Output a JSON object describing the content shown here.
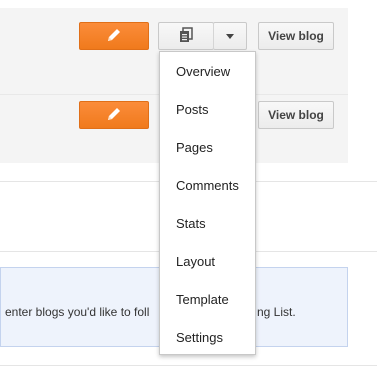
{
  "blog_rows": [
    {
      "view_blog_label": "View blog"
    },
    {
      "view_blog_label": "View blog"
    }
  ],
  "notice": {
    "text_left": "enter blogs you'd like to foll",
    "text_right": "ng List."
  },
  "dropdown_menu": {
    "items": [
      "Overview",
      "Posts",
      "Pages",
      "Comments",
      "Stats",
      "Layout",
      "Template",
      "Settings"
    ]
  },
  "colors": {
    "edit_button": "#f57f22",
    "notice_background": "#eef3fc",
    "panel_background": "#f4f4f4"
  },
  "icons": {
    "edit": "pencil-icon",
    "posts": "posts-document-icon",
    "dropdown": "caret-down-icon"
  }
}
